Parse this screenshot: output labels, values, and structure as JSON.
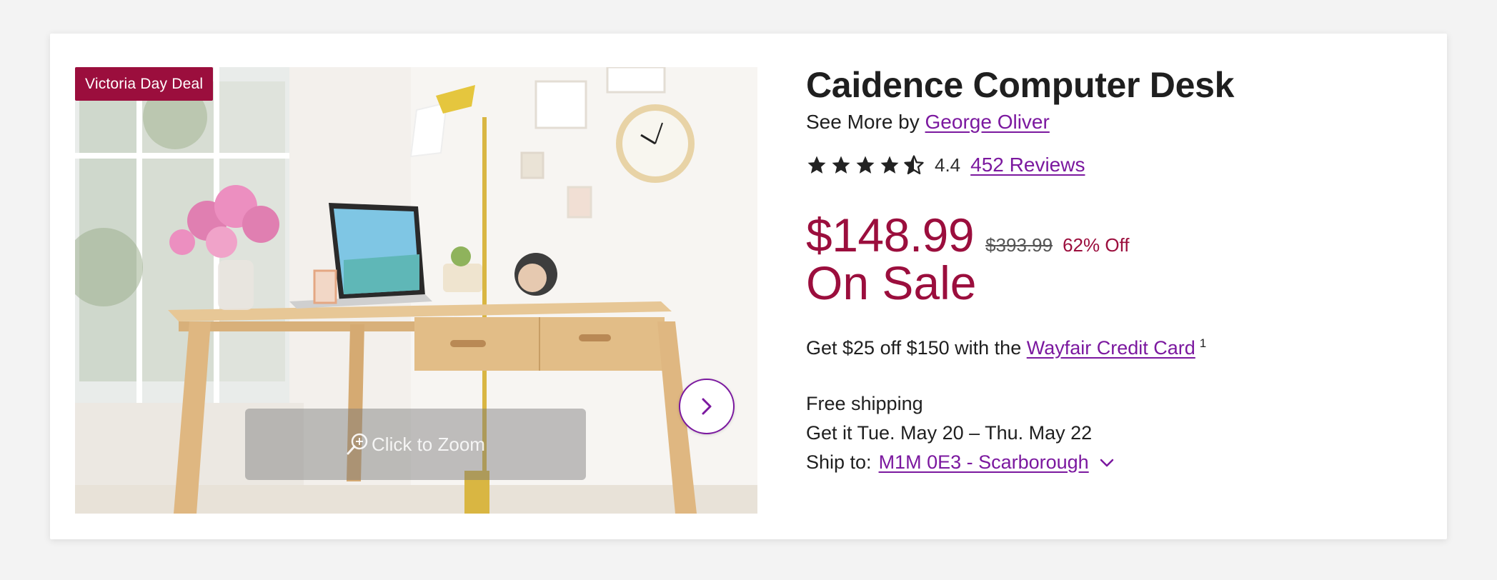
{
  "product": {
    "badge": "Victoria Day Deal",
    "zoom_label": "Click to Zoom",
    "title": "Caidence Computer Desk",
    "see_more_prefix": "See More by",
    "brand": "George Oliver",
    "rating": {
      "value": "4.4",
      "stars_filled": 4.4,
      "stars_total": 5,
      "reviews_label": "452 Reviews"
    },
    "price": {
      "current": "$148.99",
      "original": "$393.99",
      "discount": "62% Off",
      "sale_label": "On Sale"
    },
    "credit": {
      "prefix": "Get $25 off $150 with the",
      "link": "Wayfair Credit Card",
      "footnote": "1"
    },
    "shipping": {
      "free": "Free shipping",
      "delivery": "Get it Tue. May 20 – Thu. May 22",
      "ship_to_label": "Ship to:",
      "location": "M1M 0E3 - Scarborough"
    }
  },
  "icons": {
    "star": "star-icon",
    "zoom": "zoom-icon",
    "next": "chevron-right-icon",
    "dropdown": "chevron-down-icon"
  },
  "colors": {
    "sale": "#9b0e3d",
    "link": "#7b189f",
    "badge_bg": "#9b0e3d",
    "text": "#1f1f1f"
  }
}
